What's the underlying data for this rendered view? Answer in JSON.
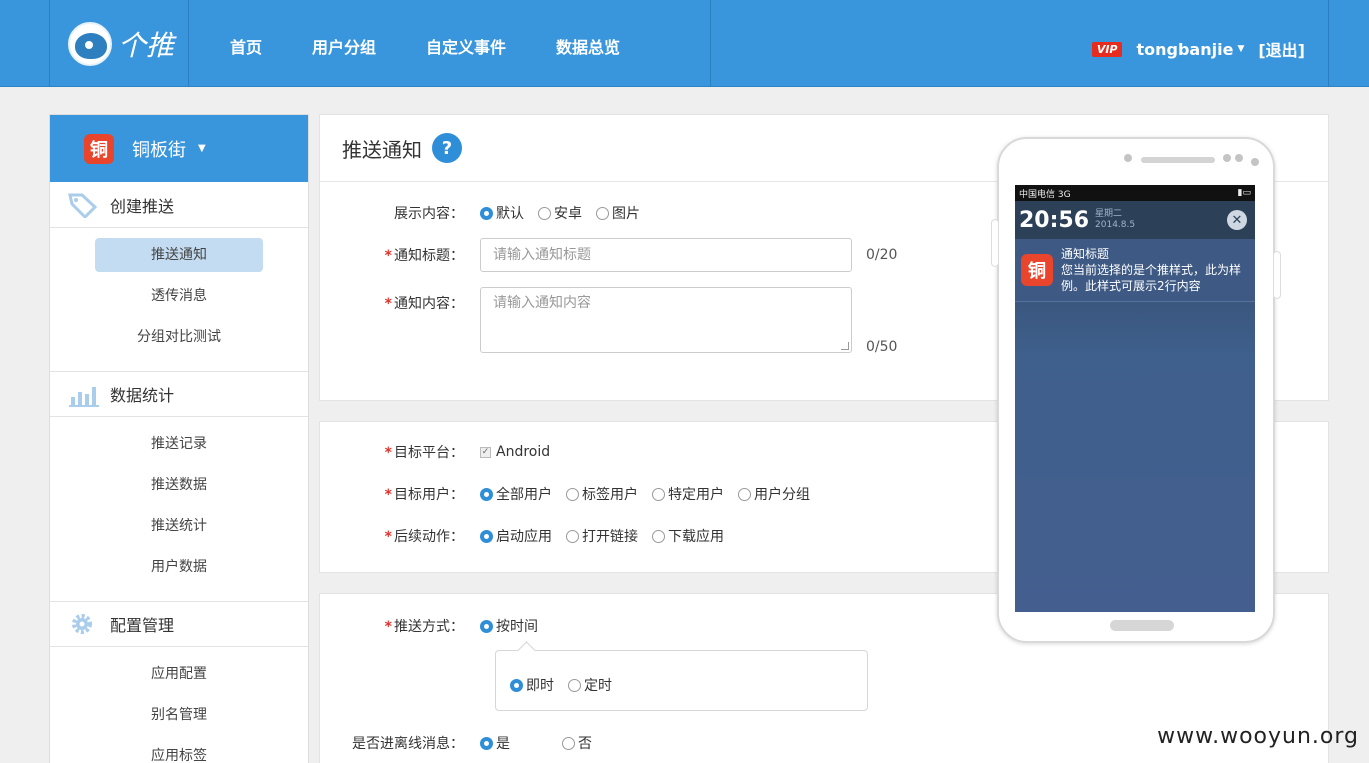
{
  "header": {
    "logo_text": "个推",
    "nav": [
      "首页",
      "用户分组",
      "自定义事件",
      "数据总览"
    ],
    "vip": "VIP",
    "username": "tongbanjie",
    "logout": "[退出]"
  },
  "sidebar": {
    "app_name": "铜板街",
    "app_icon": "铜",
    "sections": [
      {
        "title": "创建推送",
        "icon": "tag-icon",
        "items": [
          "推送通知",
          "透传消息",
          "分组对比测试"
        ]
      },
      {
        "title": "数据统计",
        "icon": "bar-chart-icon",
        "items": [
          "推送记录",
          "推送数据",
          "推送统计",
          "用户数据"
        ]
      },
      {
        "title": "配置管理",
        "icon": "gear-icon",
        "items": [
          "应用配置",
          "别名管理",
          "应用标签"
        ]
      }
    ]
  },
  "form": {
    "title": "推送通知",
    "help": "?",
    "display_label": "展示内容：",
    "display_options": [
      "默认",
      "安卓",
      "图片"
    ],
    "title_label": "通知标题：",
    "title_placeholder": "请输入通知标题",
    "title_count": "0/20",
    "content_label": "通知内容：",
    "content_placeholder": "请输入通知内容",
    "content_count": "0/50",
    "platform_label": "目标平台：",
    "platform_value": "Android",
    "users_label": "目标用户：",
    "users_options": [
      "全部用户",
      "标签用户",
      "特定用户",
      "用户分组"
    ],
    "action_label": "后续动作：",
    "action_options": [
      "启动应用",
      "打开链接",
      "下载应用"
    ],
    "method_label": "推送方式：",
    "method_value": "按时间",
    "timing_options": [
      "即时",
      "定时"
    ],
    "offline_label": "是否进离线消息：",
    "offline_options": [
      "是",
      "否"
    ]
  },
  "phone": {
    "carrier": "中国电信 3G",
    "time": "20:56",
    "weekday": "星期二",
    "date": "2014.8.5",
    "notif_icon": "铜",
    "notif_title": "通知标题",
    "notif_body": "您当前选择的是个推样式，此为样例。此样式可展示2行内容"
  },
  "watermark": "www.wooyun.org",
  "colors": {
    "brand_blue": "#3996dd",
    "required_red": "#e0322b",
    "vip_red": "#e72b1f"
  }
}
